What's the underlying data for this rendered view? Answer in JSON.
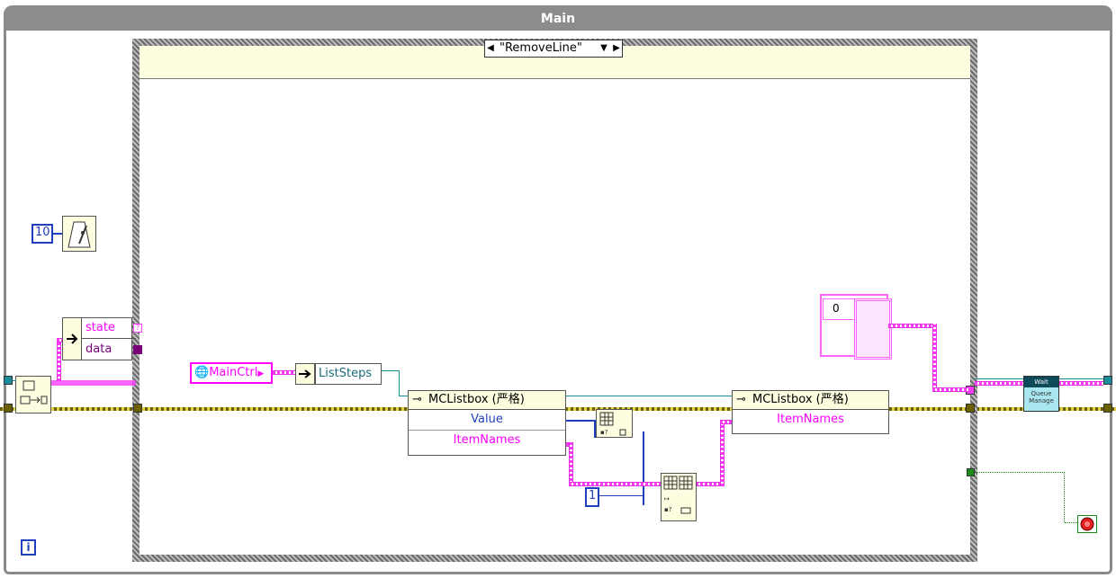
{
  "loop": {
    "title": "Main",
    "iteration_terminal": "i"
  },
  "case_structure": {
    "selector_value": "\"RemoveLine\"",
    "left_arrow": "◀",
    "right_arrow": "▶",
    "dropdown_arrow": "▼"
  },
  "wait_constant": "10",
  "unbundle": {
    "state_label": "state",
    "data_label": "data",
    "state_terminal": "?"
  },
  "global_ref": {
    "label": "MainCtrl"
  },
  "ref_prop": {
    "label": "ListSteps"
  },
  "property_node_1": {
    "class_label": "MCListbox (严格)",
    "rows": [
      "Value",
      "ItemNames"
    ]
  },
  "property_node_2": {
    "class_label": "MCListbox (严格)",
    "rows": [
      "ItemNames"
    ]
  },
  "index_constant": "1",
  "array_constant": "0",
  "queue_manager": {
    "top": "Wait",
    "bottom": "Queue Manage"
  },
  "colors": {
    "pink_wire": "#ff3cff",
    "teal_wire": "#1b8e9a",
    "blue_wire": "#1f3fbf",
    "error_wire": "#6a6000",
    "node_bg": "#fdfde0"
  }
}
